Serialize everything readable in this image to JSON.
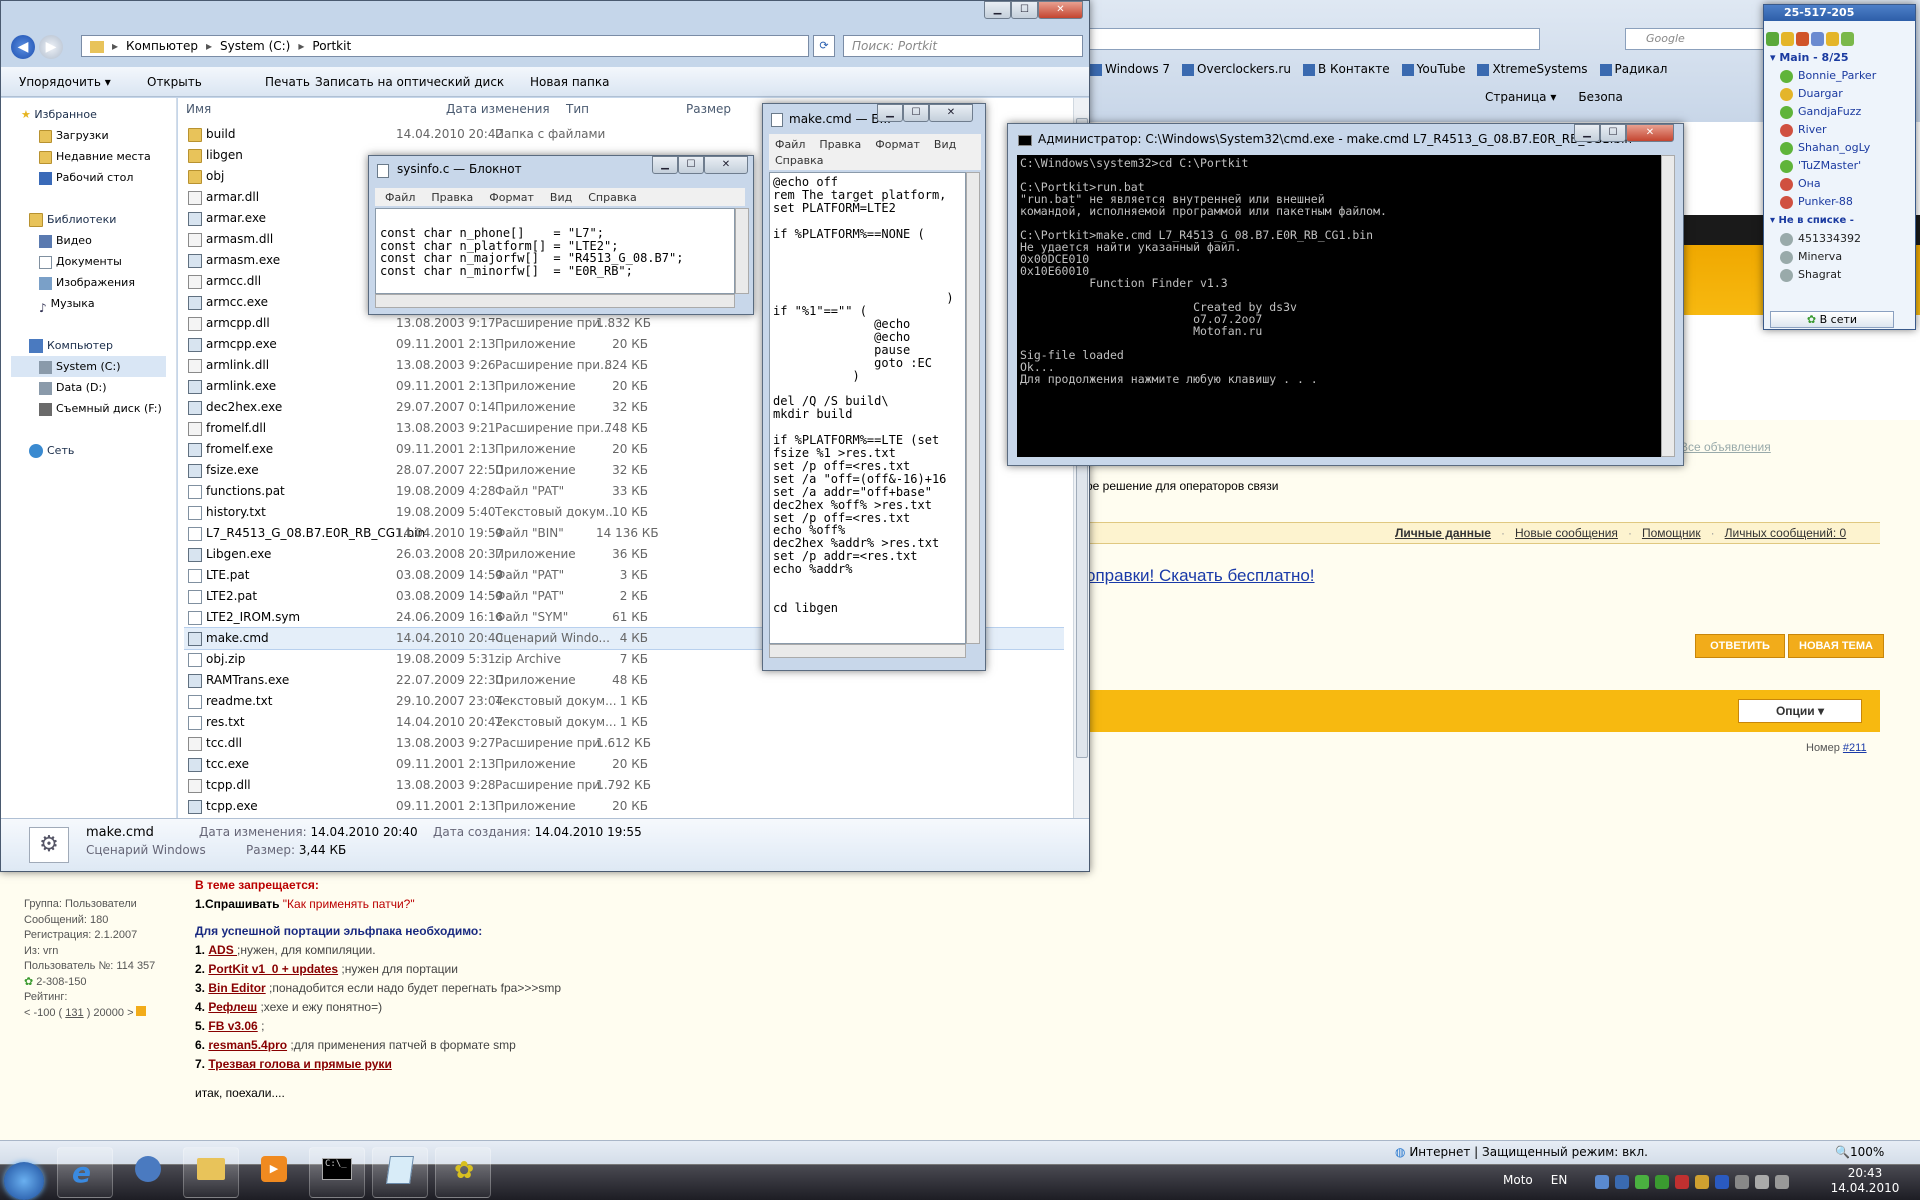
{
  "explorer": {
    "breadcrumb": [
      "Компьютер",
      "System (C:)",
      "Portkit"
    ],
    "search_placeholder": "Поиск: Portkit",
    "toolbar": [
      "Упорядочить ▾",
      "Открыть",
      "Печать",
      "Записать на оптический диск",
      "Новая папка"
    ],
    "columns": {
      "name": "Имя",
      "date": "Дата изменения",
      "type": "Тип",
      "size": "Размер"
    },
    "nav": {
      "favorites": "Избранное",
      "favorites_items": [
        "Загрузки",
        "Недавние места",
        "Рабочий стол"
      ],
      "libraries": "Библиотеки",
      "library_items": [
        "Видео",
        "Документы",
        "Изображения",
        "Музыка"
      ],
      "computer": "Компьютер",
      "drives": [
        "System (C:)",
        "Data (D:)",
        "Съемный диск (F:)"
      ],
      "network": "Сеть"
    },
    "files": [
      {
        "name": "build",
        "date": "14.04.2010 20:42",
        "type": "Папка с файлами",
        "size": "",
        "icon": "folder"
      },
      {
        "name": "libgen",
        "date": "",
        "type": "",
        "size": "",
        "icon": "folder"
      },
      {
        "name": "obj",
        "date": "",
        "type": "",
        "size": "",
        "icon": "folder"
      },
      {
        "name": "armar.dll",
        "date": "",
        "type": "",
        "size": "",
        "icon": "dll"
      },
      {
        "name": "armar.exe",
        "date": "",
        "type": "",
        "size": "",
        "icon": "exe"
      },
      {
        "name": "armasm.dll",
        "date": "",
        "type": "",
        "size": "",
        "icon": "dll"
      },
      {
        "name": "armasm.exe",
        "date": "",
        "type": "",
        "size": "",
        "icon": "exe"
      },
      {
        "name": "armcc.dll",
        "date": "",
        "type": "",
        "size": "",
        "icon": "dll"
      },
      {
        "name": "armcc.exe",
        "date": "",
        "type": "",
        "size": "",
        "icon": "exe"
      },
      {
        "name": "armcpp.dll",
        "date": "13.08.2003 9:17",
        "type": "Расширение при...",
        "size": "1 832 КБ",
        "icon": "dll"
      },
      {
        "name": "armcpp.exe",
        "date": "09.11.2001 2:13",
        "type": "Приложение",
        "size": "20 КБ",
        "icon": "exe"
      },
      {
        "name": "armlink.dll",
        "date": "13.08.2003 9:26",
        "type": "Расширение при...",
        "size": "824 КБ",
        "icon": "dll"
      },
      {
        "name": "armlink.exe",
        "date": "09.11.2001 2:13",
        "type": "Приложение",
        "size": "20 КБ",
        "icon": "exe"
      },
      {
        "name": "dec2hex.exe",
        "date": "29.07.2007 0:14",
        "type": "Приложение",
        "size": "32 КБ",
        "icon": "exe"
      },
      {
        "name": "fromelf.dll",
        "date": "13.08.2003 9:21",
        "type": "Расширение при...",
        "size": "748 КБ",
        "icon": "dll"
      },
      {
        "name": "fromelf.exe",
        "date": "09.11.2001 2:13",
        "type": "Приложение",
        "size": "20 КБ",
        "icon": "exe"
      },
      {
        "name": "fsize.exe",
        "date": "28.07.2007 22:50",
        "type": "Приложение",
        "size": "32 КБ",
        "icon": "exe"
      },
      {
        "name": "functions.pat",
        "date": "19.08.2009 4:28",
        "type": "Файл \"PAT\"",
        "size": "33 КБ",
        "icon": "file"
      },
      {
        "name": "history.txt",
        "date": "19.08.2009 5:40",
        "type": "Текстовый докум...",
        "size": "10 КБ",
        "icon": "file"
      },
      {
        "name": "L7_R4513_G_08.B7.E0R_RB_CG1.bin",
        "date": "14.04.2010 19:59",
        "type": "Файл \"BIN\"",
        "size": "14 136 КБ",
        "icon": "file"
      },
      {
        "name": "Libgen.exe",
        "date": "26.03.2008 20:37",
        "type": "Приложение",
        "size": "36 КБ",
        "icon": "exe"
      },
      {
        "name": "LTE.pat",
        "date": "03.08.2009 14:59",
        "type": "Файл \"PAT\"",
        "size": "3 КБ",
        "icon": "file"
      },
      {
        "name": "LTE2.pat",
        "date": "03.08.2009 14:59",
        "type": "Файл \"PAT\"",
        "size": "2 КБ",
        "icon": "file"
      },
      {
        "name": "LTE2_IROM.sym",
        "date": "24.06.2009 16:16",
        "type": "Файл \"SYM\"",
        "size": "61 КБ",
        "icon": "file"
      },
      {
        "name": "make.cmd",
        "date": "14.04.2010 20:40",
        "type": "Сценарий Windo...",
        "size": "4 КБ",
        "icon": "exe",
        "selected": true
      },
      {
        "name": "obj.zip",
        "date": "19.08.2009 5:31",
        "type": "zip Archive",
        "size": "7 КБ",
        "icon": "file"
      },
      {
        "name": "RAMTrans.exe",
        "date": "22.07.2009 22:30",
        "type": "Приложение",
        "size": "48 КБ",
        "icon": "exe"
      },
      {
        "name": "readme.txt",
        "date": "29.10.2007 23:04",
        "type": "Текстовый докум...",
        "size": "1 КБ",
        "icon": "file"
      },
      {
        "name": "res.txt",
        "date": "14.04.2010 20:42",
        "type": "Текстовый докум...",
        "size": "1 КБ",
        "icon": "file"
      },
      {
        "name": "tcc.dll",
        "date": "13.08.2003 9:27",
        "type": "Расширение при...",
        "size": "1 612 КБ",
        "icon": "dll"
      },
      {
        "name": "tcc.exe",
        "date": "09.11.2001 2:13",
        "type": "Приложение",
        "size": "20 КБ",
        "icon": "exe"
      },
      {
        "name": "tcpp.dll",
        "date": "13.08.2003 9:28",
        "type": "Расширение при...",
        "size": "1 792 КБ",
        "icon": "dll"
      },
      {
        "name": "tcpp.exe",
        "date": "09.11.2001 2:13",
        "type": "Приложение",
        "size": "20 КБ",
        "icon": "exe"
      }
    ],
    "status": {
      "filename": "make.cmd",
      "filetype": "Сценарий Windows",
      "modified_label": "Дата изменения:",
      "modified": "14.04.2010 20:40",
      "created_label": "Дата создания:",
      "created": "14.04.2010 19:55",
      "size_label": "Размер:",
      "size": "3,44 КБ"
    }
  },
  "notepad1": {
    "title": "sysinfo.c — Блокнот",
    "menu": [
      "Файл",
      "Правка",
      "Формат",
      "Вид",
      "Справка"
    ],
    "text": "const char n_phone[]    = \"L7\";\nconst char n_platform[] = \"LTE2\";\nconst char n_majorfw[]  = \"R4513_G_08.B7\";\nconst char n_minorfw[]  = \"E0R_RB\";"
  },
  "notepad2": {
    "title": "make.cmd — Б...",
    "menu": [
      "Файл",
      "Правка",
      "Формат",
      "Вид",
      "Справка"
    ],
    "text": "@echo off\nrem The target platform,\nset PLATFORM=LTE2\n\nif %PLATFORM%==NONE (\n\n\n\n\n                        )\nif \"%1\"==\"\" (\n              @echo\n              @echo\n              pause\n              goto :EC\n           )\n\ndel /Q /S build\\\nmkdir build\n\nif %PLATFORM%==LTE (set\nfsize %1 >res.txt\nset /p off=<res.txt\nset /a \"off=(off&-16)+16\nset /a addr=\"off+base\"\ndec2hex %off% >res.txt\nset /p off=<res.txt\necho %off%\ndec2hex %addr% >res.txt\nset /p addr=<res.txt\necho %addr%\n\n\ncd libgen"
  },
  "cmd": {
    "title": "Администратор: C:\\Windows\\System32\\cmd.exe - make.cmd  L7_R4513_G_08.B7.E0R_RB_CG1.bin",
    "text": "C:\\Windows\\system32>cd C:\\Portkit\n\nC:\\Portkit>run.bat\n\"run.bat\" не является внутренней или внешней\nкомандой, исполняемой программой или пакетным файлом.\n\nC:\\Portkit>make.cmd L7_R4513_G_08.B7.E0R_RB_CG1.bin\nНе удается найти указанный файл.\n0x00DCE010\n0x10E60010\n          Function Finder v1.3\n\n                         Created by ds3v\n                         o7.o7.2oo7\n                         Motofan.ru\n\nSig-file loaded\nOk...\nДля продолжения нажмите любую клавишу . . ."
  },
  "browser": {
    "search_placeholder": "Google",
    "bookmarks": [
      "Windows 7",
      "Overclockers.ru",
      "В Контакте",
      "YouTube",
      "XtremeSystems",
      "Радикал"
    ],
    "cmdbar": [
      "Страница ▾",
      "Безопа"
    ],
    "links": {
      "all_ads": "Все объявления",
      "ad2": "ь объявление",
      "operators": "ое решение для операторов связи",
      "banner": "оправки! Скачать бесплатно!"
    },
    "userbar": [
      "Личные данные",
      "Новые сообщения",
      "Помощник",
      "Личных сообщений: 0"
    ],
    "reply": "ОТВЕТИТЬ",
    "newtopic": "НОВАЯ ТЕМА",
    "options": "Опции ▾",
    "number_label": "Номер",
    "number": "#211",
    "user": {
      "group": "Группа: Пользователи",
      "posts": "Сообщений: 180",
      "reg": "Регистрация: 2.1.2007",
      "from": "Из: vrn",
      "num": "Пользователь №: 114 357",
      "icq": "2-308-150",
      "rating": "Рейтинг:",
      "rating_val": "< -100 (",
      "rating_n": "131",
      "rating_end": ") 20000 >"
    },
    "post": {
      "forbid": "В теме запрещается:",
      "l1a": "1.Спрашивать ",
      "l1b": "\"Как применять патчи?\"",
      "need": "Для успешной портации эльфпака необходимо:",
      "items": [
        {
          "n": "1.",
          "link": "ADS ",
          "rest": ";нужен, для компиляции."
        },
        {
          "n": "2.",
          "link": "PortKit v1_0 + updates",
          "rest": ";нужен для портации"
        },
        {
          "n": "3.",
          "link": "Bin Editor",
          "rest": ";понадобится если надо будет перегнать fpa>>>smp"
        },
        {
          "n": "4.",
          "link": "Рефлеш",
          "rest": ";хехе и ежу понятно=)"
        },
        {
          "n": "5.",
          "link": "FB v3.06",
          "rest": ";"
        },
        {
          "n": "6.",
          "link": "resman5.4pro",
          "rest": ";для применения патчей в формате smp"
        },
        {
          "n": "7.",
          "link": "Трезвая голова и прямые руки",
          "rest": ""
        }
      ],
      "end": "итак, поехали...."
    },
    "status": "Интернет | Защищенный режим: вкл.",
    "zoom": "100%"
  },
  "qip": {
    "title": "25-517-205",
    "group": "Main - 8/25",
    "contacts": [
      "Bonnie_Parker",
      "Duargar",
      "GandjaFuzz",
      "River",
      "Shahan_ogLy",
      "'TuZMaster'",
      "Она",
      "Punker-88"
    ],
    "notlist": "Не в списке -",
    "others": [
      "451334392",
      "Minerva",
      "Shagrat"
    ],
    "status": "В сети"
  },
  "taskbar": {
    "lang_label": "Moto",
    "lang": "EN",
    "time": "20:43",
    "date": "14.04.2010"
  }
}
